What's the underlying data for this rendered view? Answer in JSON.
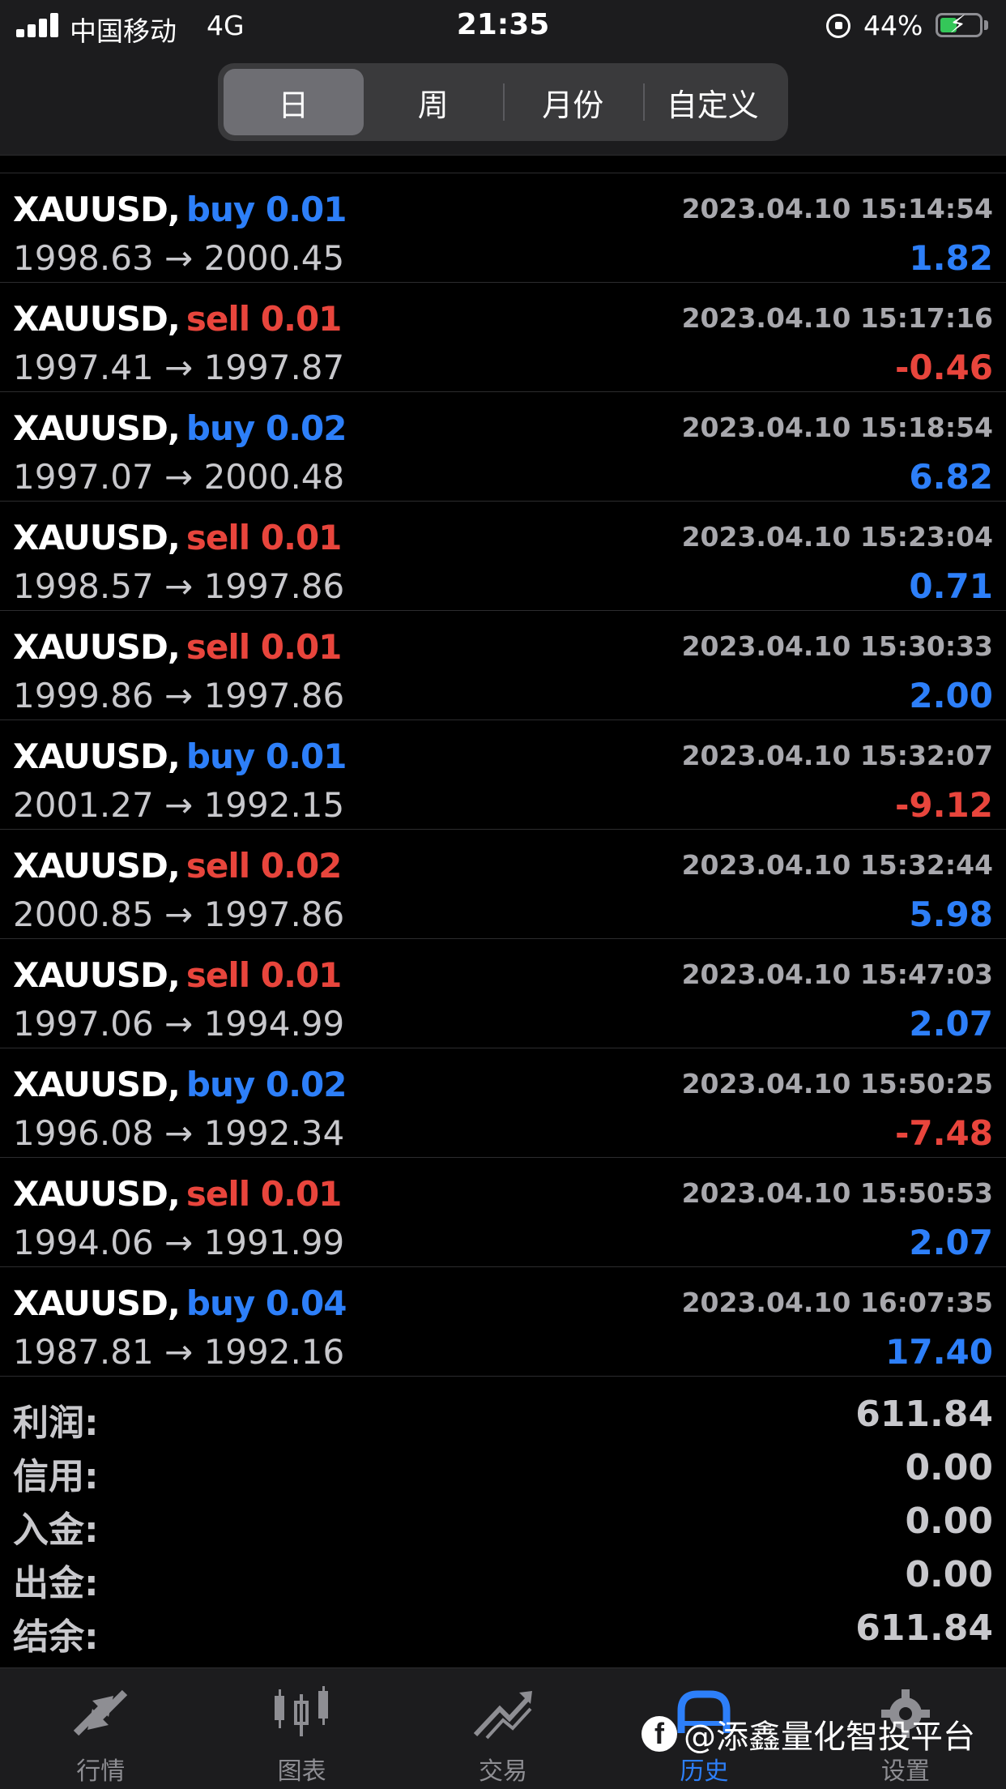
{
  "status_bar": {
    "carrier": "中国移动",
    "network": "4G",
    "time": "21:35",
    "battery_percent": "44%",
    "battery_level": 0.44
  },
  "period_tabs": [
    {
      "label": "日",
      "active": true
    },
    {
      "label": "周",
      "active": false
    },
    {
      "label": "月份",
      "active": false
    },
    {
      "label": "自定义",
      "active": false
    }
  ],
  "trades": [
    {
      "symbol": "XAUUSD,",
      "side": "buy",
      "volume": "0.01",
      "time": "2023.04.10 15:14:54",
      "prices": "1998.63 → 2000.45",
      "profit": "1.82",
      "profit_sign": "pos"
    },
    {
      "symbol": "XAUUSD,",
      "side": "sell",
      "volume": "0.01",
      "time": "2023.04.10 15:17:16",
      "prices": "1997.41 → 1997.87",
      "profit": "-0.46",
      "profit_sign": "neg"
    },
    {
      "symbol": "XAUUSD,",
      "side": "buy",
      "volume": "0.02",
      "time": "2023.04.10 15:18:54",
      "prices": "1997.07 → 2000.48",
      "profit": "6.82",
      "profit_sign": "pos"
    },
    {
      "symbol": "XAUUSD,",
      "side": "sell",
      "volume": "0.01",
      "time": "2023.04.10 15:23:04",
      "prices": "1998.57 → 1997.86",
      "profit": "0.71",
      "profit_sign": "pos"
    },
    {
      "symbol": "XAUUSD,",
      "side": "sell",
      "volume": "0.01",
      "time": "2023.04.10 15:30:33",
      "prices": "1999.86 → 1997.86",
      "profit": "2.00",
      "profit_sign": "pos"
    },
    {
      "symbol": "XAUUSD,",
      "side": "buy",
      "volume": "0.01",
      "time": "2023.04.10 15:32:07",
      "prices": "2001.27 → 1992.15",
      "profit": "-9.12",
      "profit_sign": "neg"
    },
    {
      "symbol": "XAUUSD,",
      "side": "sell",
      "volume": "0.02",
      "time": "2023.04.10 15:32:44",
      "prices": "2000.85 → 1997.86",
      "profit": "5.98",
      "profit_sign": "pos"
    },
    {
      "symbol": "XAUUSD,",
      "side": "sell",
      "volume": "0.01",
      "time": "2023.04.10 15:47:03",
      "prices": "1997.06 → 1994.99",
      "profit": "2.07",
      "profit_sign": "pos"
    },
    {
      "symbol": "XAUUSD,",
      "side": "buy",
      "volume": "0.02",
      "time": "2023.04.10 15:50:25",
      "prices": "1996.08 → 1992.34",
      "profit": "-7.48",
      "profit_sign": "neg"
    },
    {
      "symbol": "XAUUSD,",
      "side": "sell",
      "volume": "0.01",
      "time": "2023.04.10 15:50:53",
      "prices": "1994.06 → 1991.99",
      "profit": "2.07",
      "profit_sign": "pos"
    },
    {
      "symbol": "XAUUSD,",
      "side": "buy",
      "volume": "0.04",
      "time": "2023.04.10 16:07:35",
      "prices": "1987.81 → 1992.16",
      "profit": "17.40",
      "profit_sign": "pos"
    }
  ],
  "summary": [
    {
      "label": "利润:",
      "value": "611.84"
    },
    {
      "label": "信用:",
      "value": "0.00"
    },
    {
      "label": "入金:",
      "value": "0.00"
    },
    {
      "label": "出金:",
      "value": "0.00"
    },
    {
      "label": "结余:",
      "value": "611.84"
    }
  ],
  "bottom_tabs": [
    {
      "label": "行情",
      "icon": "quotes-arrows-icon",
      "active": false
    },
    {
      "label": "图表",
      "icon": "candlestick-chart-icon",
      "active": false
    },
    {
      "label": "交易",
      "icon": "trade-line-icon",
      "active": false
    },
    {
      "label": "历史",
      "icon": "history-icon",
      "active": true
    },
    {
      "label": "设置",
      "icon": "gear-icon",
      "active": false
    }
  ],
  "watermark": {
    "text": "@添鑫量化智投平台",
    "icon": "facebook-icon"
  },
  "colors": {
    "buy": "#2d7ff9",
    "sell": "#e8453c",
    "active_tab": "#2d7ff9"
  }
}
